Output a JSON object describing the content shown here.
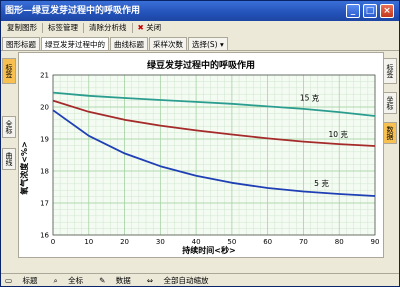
{
  "window": {
    "title": "图形—绿豆发芽过程中的呼吸作用"
  },
  "menu": [
    "复制图形",
    "标签管理",
    "清除分析线",
    "关闭"
  ],
  "tabs": [
    "图形标题",
    "绿豆发芽过程中的",
    "曲线标题",
    "采样次数",
    "选择(S)"
  ],
  "left_rail": [
    "标签",
    "全标",
    "曲线"
  ],
  "right_rail": [
    "标签",
    "坐标",
    "数据"
  ],
  "status": [
    "标题",
    "全标",
    "数据",
    "全部自动缩放"
  ],
  "chart_data": {
    "type": "line",
    "title": "绿豆发芽过程中的呼吸作用",
    "xlabel": "持续时间<秒>",
    "ylabel": "氧气浓度<%>",
    "xlim": [
      0,
      90
    ],
    "ylim": [
      16,
      21
    ],
    "xticks": [
      0,
      10,
      20,
      30,
      40,
      50,
      60,
      70,
      80,
      90
    ],
    "yticks": [
      16,
      17,
      18,
      19,
      20,
      21
    ],
    "grid": true,
    "series": [
      {
        "name": "15 克",
        "color": "#2a9d8f",
        "x": [
          0,
          10,
          20,
          30,
          40,
          50,
          60,
          70,
          80,
          90
        ],
        "y": [
          20.45,
          20.35,
          20.28,
          20.22,
          20.16,
          20.1,
          20.02,
          19.94,
          19.84,
          19.72
        ]
      },
      {
        "name": "10 克",
        "color": "#a52a2a",
        "x": [
          0,
          10,
          20,
          30,
          40,
          50,
          60,
          70,
          80,
          90
        ],
        "y": [
          20.2,
          19.85,
          19.6,
          19.42,
          19.27,
          19.14,
          19.02,
          18.92,
          18.84,
          18.78
        ]
      },
      {
        "name": "5 克",
        "color": "#1f3fb4",
        "x": [
          0,
          10,
          20,
          30,
          40,
          50,
          60,
          70,
          80,
          90
        ],
        "y": [
          19.9,
          19.1,
          18.55,
          18.15,
          17.85,
          17.63,
          17.47,
          17.36,
          17.28,
          17.22
        ]
      }
    ],
    "annotations": [
      "15 克",
      "10 克",
      "5 克"
    ]
  }
}
